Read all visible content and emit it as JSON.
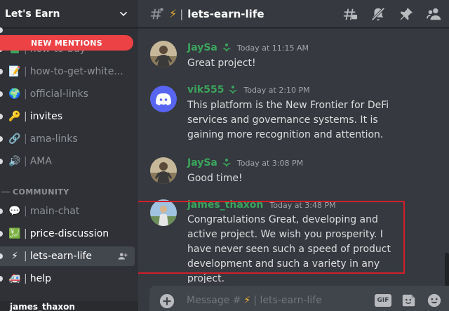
{
  "server": {
    "name": "Let's Earn"
  },
  "sidebar": {
    "new_mentions": "NEW MENTIONS",
    "channels": [
      {
        "emoji": "",
        "label": "how-to-buy",
        "state": "normal"
      },
      {
        "emoji": "📝",
        "label": "how-to-get-white...",
        "state": "normal"
      },
      {
        "emoji": "🌍",
        "label": "official-links",
        "state": "normal"
      },
      {
        "emoji": "🔑",
        "label": "invites",
        "state": "unread"
      },
      {
        "emoji": "🔗",
        "label": "ama-links",
        "state": "normal"
      },
      {
        "emoji": "🔊",
        "label": "AMA",
        "state": "normal"
      }
    ],
    "category": "COMMUNITY",
    "community_channels": [
      {
        "emoji": "💬",
        "label": "main-chat",
        "state": "normal"
      },
      {
        "emoji": "💹",
        "label": "price-discussion",
        "state": "unread"
      },
      {
        "emoji": "⚡",
        "label": "lets-earn-life",
        "state": "selected"
      },
      {
        "emoji": "🚑",
        "label": "help",
        "state": "unread"
      }
    ],
    "user": {
      "name": "james_thaxon"
    }
  },
  "header": {
    "emoji": "⚡",
    "separator": "|",
    "title": "lets-earn-life",
    "icons": [
      "threads-icon",
      "mute-icon",
      "pin-icon",
      "members-icon"
    ]
  },
  "messages": [
    {
      "author": "JaySa",
      "timestamp": "Today at 11:15 AM",
      "text": "Great project!",
      "avatar": "photo"
    },
    {
      "author": "vik555",
      "timestamp": "Today at 2:10 PM",
      "text": "This platform is the New Frontier for DeFi services and governance systems. It is gaining more recognition and attention.",
      "avatar": "discord"
    },
    {
      "author": "JaySa",
      "timestamp": "Today at 3:08 PM",
      "text": "Good time!",
      "avatar": "photo"
    },
    {
      "author": "james_thaxon",
      "timestamp": "Today at 3:48 PM",
      "text": "Congratulations Great, developing and active project. We wish you prosperity. I have never seen such a speed of product development and such a variety in any project.",
      "avatar": "photo2"
    }
  ],
  "composer": {
    "placeholder_prefix": "Message #",
    "placeholder_emoji": "⚡",
    "placeholder_channel": "| lets-earn-life",
    "gif_label": "GIF"
  },
  "colors": {
    "author": "#3ba55d",
    "highlight": "#d21f2b",
    "mentions": "#ed4245",
    "discord_blurple": "#5865f2"
  }
}
